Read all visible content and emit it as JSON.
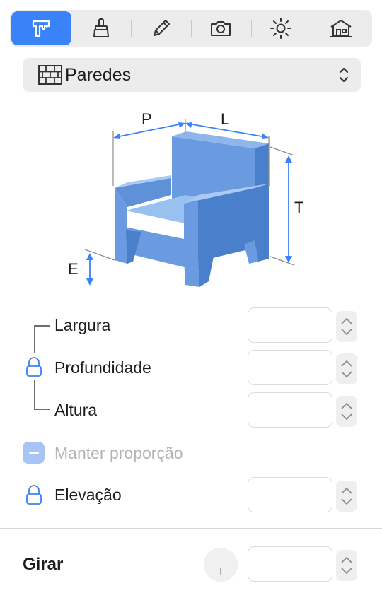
{
  "toolbar": {
    "tools": [
      {
        "icon": "caliper-icon",
        "active": true
      },
      {
        "icon": "paint-brush-icon",
        "active": false
      },
      {
        "icon": "pencil-icon",
        "active": false
      },
      {
        "icon": "camera-icon",
        "active": false
      },
      {
        "icon": "sun-icon",
        "active": false
      },
      {
        "icon": "house-icon",
        "active": false
      }
    ]
  },
  "dropdown": {
    "label": "Paredes",
    "icon": "brick-wall-icon"
  },
  "diagram": {
    "p": "P",
    "l": "L",
    "t": "T",
    "e": "E"
  },
  "fields": {
    "largura": {
      "label": "Largura",
      "value": ""
    },
    "profundidade": {
      "label": "Profundidade",
      "value": ""
    },
    "altura": {
      "label": "Altura",
      "value": ""
    },
    "elevacao": {
      "label": "Elevação",
      "value": ""
    }
  },
  "maintain": {
    "label": "Manter proporção"
  },
  "rotate": {
    "label": "Girar",
    "value": ""
  },
  "colors": {
    "accent": "#3a82f7",
    "chair": "#5b8fd6"
  }
}
